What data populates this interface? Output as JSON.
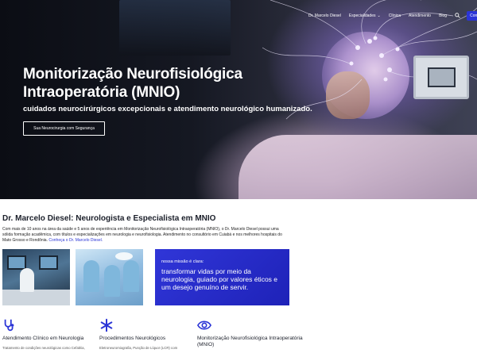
{
  "nav": {
    "items": [
      "Dr. Marcelo Diesel",
      "Especialidades",
      "Clínica",
      "Atendimento",
      "Blog"
    ],
    "cta": "Contato"
  },
  "hero": {
    "title": "Monitorização Neurofisiológica Intraoperatória (MNIO)",
    "subtitle": "cuidados neurocirúrgicos excepcionais e atendimento neurológico humanizado.",
    "button": "Sua Neurocirurgia com Segurança"
  },
  "about": {
    "heading": "Dr. Marcelo Diesel: Neurologista e Especialista em MNIO",
    "paragraph": "Com mais de 10 anos na área da saúde e 5 anos de experiência em Monitorização Neurofisiológica Intraoperatória (MNIO), o Dr. Marcelo Diesel possui uma sólida formação acadêmica, com títulos e especializações em neurologia e neurofisiologia. Atendimento no consultório em Cuiabá e nos melhores hospitais do Mato Grosso e Rondônia.",
    "link": "Conheça o Dr. Marcelo Diesel."
  },
  "mission": {
    "kicker": "nossa missão é clara:",
    "body": "transformar vidas por meio da neurologia, guiado por valores éticos e um desejo genuíno de servir."
  },
  "features": [
    {
      "icon": "stethoscope-icon",
      "title": "Atendimento Clínico em Neurologia",
      "desc": "Tratamento de condições neurológicas como Cefaléia,"
    },
    {
      "icon": "asterisk-icon",
      "title": "Procedimentos Neurológicos",
      "desc": "Eletroneuromiografia, Punção de Líquor (LCR) com"
    },
    {
      "icon": "eye-icon",
      "title": "Monitorização Neurofisiológica Intraoperatória (MNIO)",
      "desc": ""
    }
  ],
  "colors": {
    "accent": "#2b35d6"
  }
}
